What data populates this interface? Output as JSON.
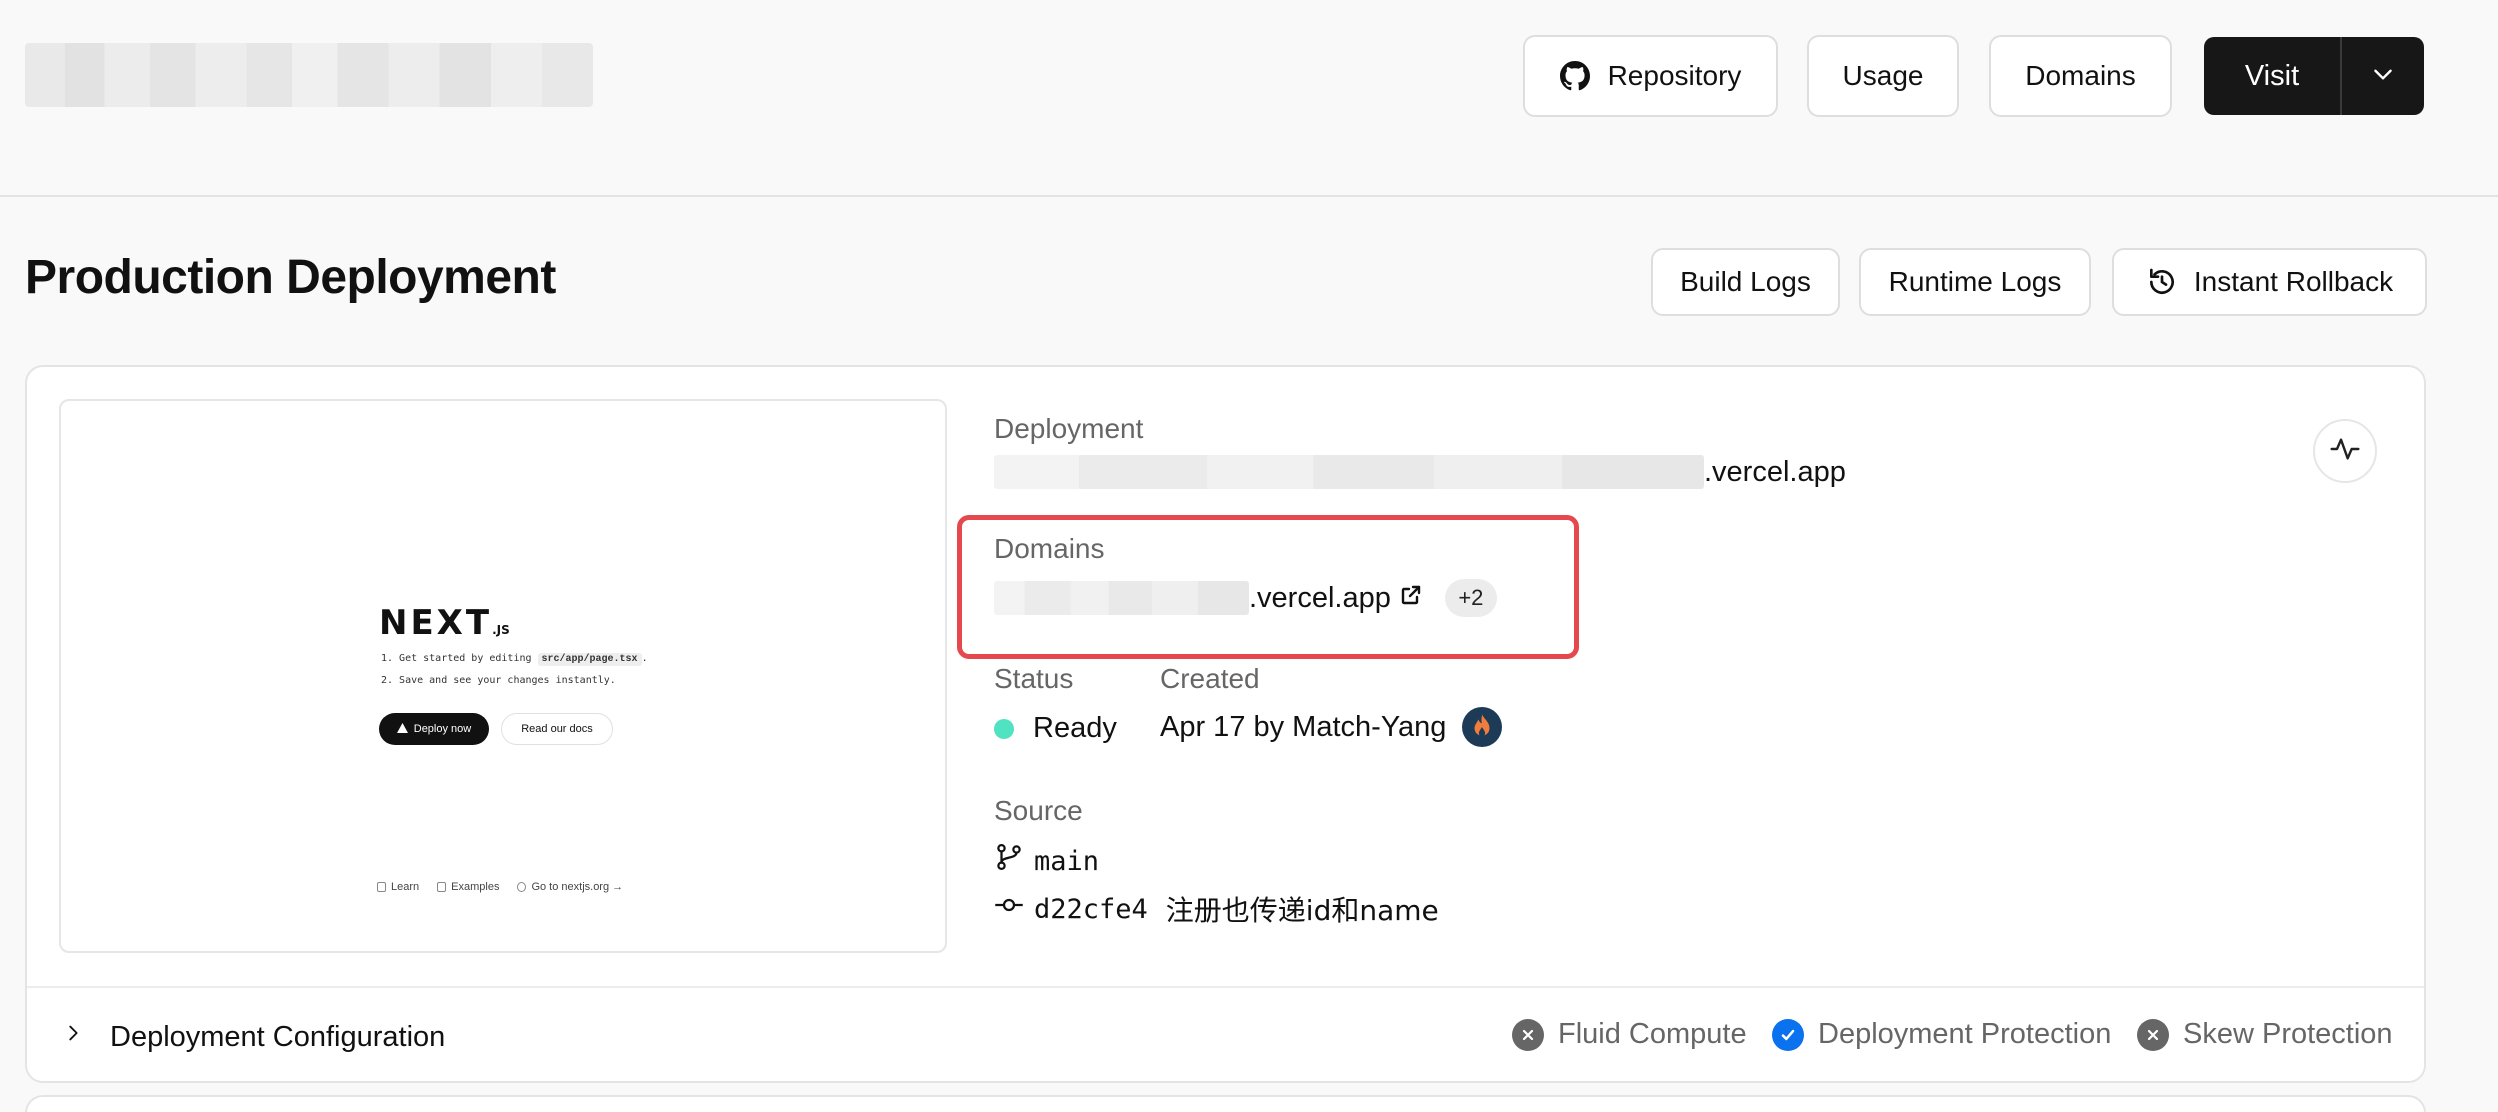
{
  "header": {
    "project_name": "",
    "buttons": {
      "repository": "Repository",
      "usage": "Usage",
      "domains": "Domains",
      "visit": "Visit"
    }
  },
  "page": {
    "title": "Production Deployment",
    "actions": {
      "build_logs": "Build Logs",
      "runtime_logs": "Runtime Logs",
      "instant_rollback": "Instant Rollback"
    }
  },
  "preview": {
    "logo_text": "NEXT",
    "logo_suffix": ".JS",
    "step1_prefix": "1. Get started by editing",
    "step1_code": "src/app/page.tsx",
    "step1_suffix": ".",
    "step2": "2. Save and see your changes instantly.",
    "deploy_label": "Deploy now",
    "docs_label": "Read our docs",
    "footer_links": [
      "Learn",
      "Examples",
      "Go to nextjs.org →"
    ]
  },
  "deployment": {
    "label": "Deployment",
    "url_suffix": ".vercel.app"
  },
  "domains": {
    "label": "Domains",
    "url_suffix": ".vercel.app",
    "extra_count": "+2"
  },
  "status": {
    "label": "Status",
    "value": "Ready",
    "color": "#50e3c2"
  },
  "created": {
    "label": "Created",
    "value": "Apr 17 by Match-Yang"
  },
  "source": {
    "label": "Source",
    "branch": "main",
    "commit_hash": "d22cfe4",
    "commit_message": "注册也传递id和name"
  },
  "configuration": {
    "label": "Deployment Configuration",
    "features": [
      {
        "name": "Fluid Compute",
        "enabled": false
      },
      {
        "name": "Deployment Protection",
        "enabled": true
      },
      {
        "name": "Skew Protection",
        "enabled": false
      }
    ]
  },
  "colors": {
    "highlight": "#e5484d",
    "accent_blue": "#0a72ef",
    "visit_bg": "#171717"
  }
}
